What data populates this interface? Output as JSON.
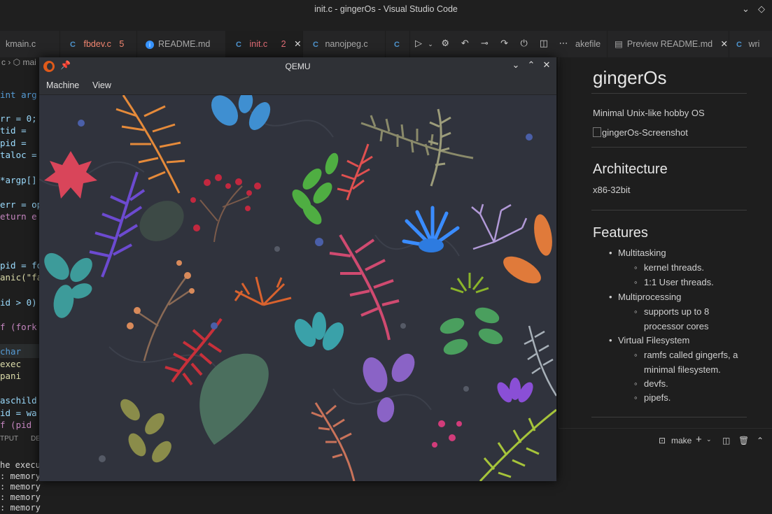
{
  "window": {
    "title": "init.c - gingerOs - Visual Studio Code"
  },
  "tabs": [
    {
      "label": "kmain.c",
      "type": "c",
      "errors": "",
      "active": false
    },
    {
      "label": "fbdev.c",
      "type": "c",
      "errors": "5",
      "active": false
    },
    {
      "label": "README.md",
      "type": "info",
      "errors": "",
      "active": false
    },
    {
      "label": "init.c",
      "type": "c",
      "errors": "2",
      "active": true
    },
    {
      "label": "nanojpeg.c",
      "type": "c",
      "errors": "",
      "active": false
    },
    {
      "label": "akefile",
      "type": "make",
      "errors": "",
      "active": false
    },
    {
      "label": "Preview README.md",
      "type": "preview",
      "errors": "",
      "active": false
    },
    {
      "label": "wri",
      "type": "c",
      "errors": "",
      "active": false
    }
  ],
  "editor": {
    "breadcrumb": "c › ⬡ mai",
    "code": [
      "int arg",
      "rr = 0;",
      " tid =",
      " pid =",
      "taloc =",
      "*argp[]",
      "err = op",
      "eturn e",
      "pid = fo",
      "anic(\"fa",
      "id > 0)",
      "f (fork",
      "  char",
      "  exec",
      "  pani",
      "aschild",
      "id = wa",
      "f (pid"
    ]
  },
  "panel": {
    "tabs": [
      "TPUT",
      "DE"
    ],
    "terminal_lines": [
      "he execut",
      "memory",
      "memory",
      "memory",
      "memory"
    ]
  },
  "preview": {
    "title": "gingerOs",
    "subtitle": "Minimal Unix-like hobby OS",
    "image_alt": "gingerOs-Screenshot",
    "arch_heading": "Architecture",
    "arch_value": "x86-32bit",
    "features_heading": "Features",
    "features": [
      {
        "label": "Multitasking",
        "sub": [
          "kernel threads.",
          "1:1 User threads."
        ]
      },
      {
        "label": "Multiprocessing",
        "sub": [
          "supports up to 8 processor cores"
        ]
      },
      {
        "label": "Virtual Filesystem",
        "sub": [
          "ramfs called gingerfs, a minimal filesystem.",
          "devfs.",
          "pipefs."
        ]
      }
    ]
  },
  "terminal_toolbar": {
    "task_label": "make"
  },
  "qemu": {
    "title": "QEMU",
    "menu": [
      "Machine",
      "View"
    ]
  },
  "colors": {
    "accent": "#3794ff",
    "error": "#f48771",
    "wallpaper_bg": "#30333d"
  }
}
